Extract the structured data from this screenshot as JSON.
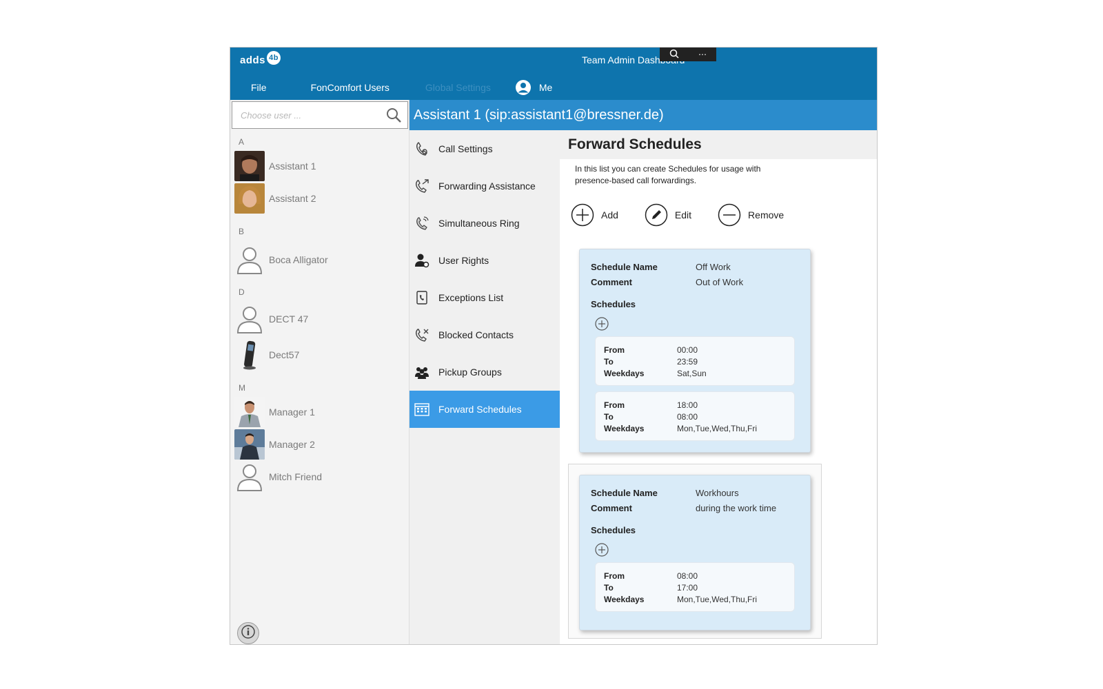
{
  "window": {
    "title": "Team Admin Dashboard",
    "logo_text": "adds",
    "logo_badge": "4b"
  },
  "menu": {
    "file": "File",
    "foncomfort_users": "FonComfort Users",
    "global_settings": "Global Settings",
    "me": "Me"
  },
  "search": {
    "placeholder": "Choose user ..."
  },
  "users": {
    "groups": [
      {
        "letter": "A",
        "items": [
          {
            "name": "Assistant 1"
          },
          {
            "name": "Assistant 2"
          }
        ]
      },
      {
        "letter": "B",
        "items": [
          {
            "name": "Boca Alligator"
          }
        ]
      },
      {
        "letter": "D",
        "items": [
          {
            "name": "DECT 47"
          },
          {
            "name": "Dect57"
          }
        ]
      },
      {
        "letter": "M",
        "items": [
          {
            "name": "Manager 1"
          },
          {
            "name": "Manager 2"
          },
          {
            "name": "Mitch Friend"
          }
        ]
      }
    ]
  },
  "header": {
    "title": "Assistant 1 (sip:assistant1@bressner.de)"
  },
  "nav": {
    "items": [
      {
        "label": "Call Settings",
        "icon": "call-settings-icon"
      },
      {
        "label": "Forwarding Assistance",
        "icon": "forwarding-icon"
      },
      {
        "label": "Simultaneous Ring",
        "icon": "simultaneous-ring-icon"
      },
      {
        "label": "User Rights",
        "icon": "user-rights-icon"
      },
      {
        "label": "Exceptions List",
        "icon": "exceptions-list-icon"
      },
      {
        "label": "Blocked Contacts",
        "icon": "blocked-contacts-icon"
      },
      {
        "label": "Pickup Groups",
        "icon": "pickup-groups-icon"
      },
      {
        "label": "Forward Schedules",
        "icon": "calendar-icon",
        "active": true
      }
    ]
  },
  "content": {
    "title": "Forward Schedules",
    "description": "In this list you can create Schedules for usage with presence-based call forwardings.",
    "toolbar": {
      "add": "Add",
      "edit": "Edit",
      "remove": "Remove"
    },
    "labels": {
      "schedule_name": "Schedule Name",
      "comment": "Comment",
      "schedules": "Schedules",
      "from": "From",
      "to": "To",
      "weekdays": "Weekdays"
    },
    "schedules": [
      {
        "name": "Off Work",
        "comment": "Out of Work",
        "slots": [
          {
            "from": "00:00",
            "to": "23:59",
            "weekdays": "Sat,Sun"
          },
          {
            "from": "18:00",
            "to": "08:00",
            "weekdays": "Mon,Tue,Wed,Thu,Fri"
          }
        ]
      },
      {
        "name": "Workhours",
        "comment": "during the work time",
        "slots": [
          {
            "from": "08:00",
            "to": "17:00",
            "weekdays": "Mon,Tue,Wed,Thu,Fri"
          }
        ]
      }
    ]
  },
  "colors": {
    "titlebar": "#0e74ad",
    "header": "#2b8ccc",
    "nav_active": "#3b9be6",
    "card": "#d9ebf8"
  }
}
